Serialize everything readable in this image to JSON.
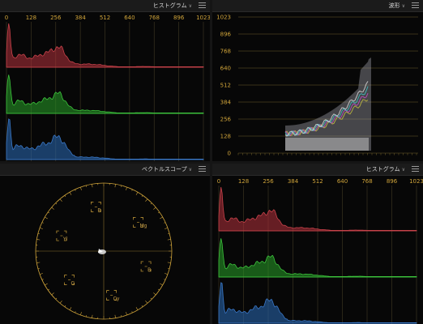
{
  "panels": {
    "histogram_top": {
      "title": "ヒストグラム",
      "x_ticks": [
        "0",
        "128",
        "256",
        "384",
        "512",
        "640",
        "768",
        "896",
        "1023"
      ]
    },
    "waveform": {
      "title": "波形",
      "y_ticks": [
        "1023",
        "896",
        "768",
        "640",
        "512",
        "384",
        "256",
        "128",
        "0"
      ]
    },
    "vectorscope": {
      "title": "ベクトルスコープ",
      "targets": [
        "R",
        "Mg",
        "B",
        "Cy",
        "G",
        "Yl"
      ]
    },
    "histogram_bottom": {
      "title": "ヒストグラム",
      "x_ticks": [
        "0",
        "128",
        "256",
        "384",
        "512",
        "640",
        "768",
        "896",
        "1023"
      ]
    }
  },
  "colors": {
    "accent": "#d0a43a",
    "red_channel": "#c8424a",
    "green_channel": "#3cc43c",
    "blue_channel": "#3a78c8",
    "background": "#070707"
  },
  "icons": {
    "dropdown": "chevron-down-icon",
    "options": "menu-lines-icon"
  }
}
